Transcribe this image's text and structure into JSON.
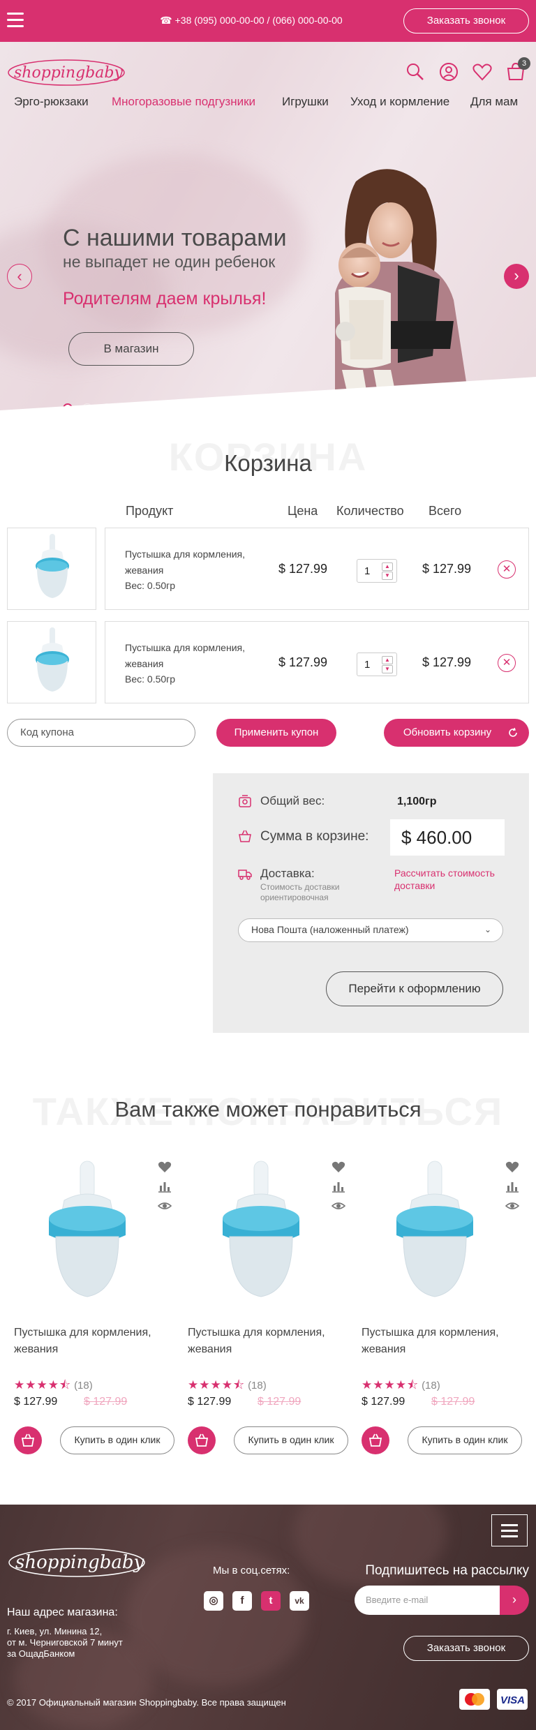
{
  "topbar": {
    "phone": "☎ +38 (095) 000-00-00 / (066) 000-00-00",
    "callback_label": "Заказать звонок"
  },
  "header": {
    "logo_text": "shoppingbaby",
    "cart_count": "3",
    "nav": [
      {
        "label": "Эрго-рюкзаки",
        "active": false
      },
      {
        "label": "Многоразовые подгузники",
        "active": true
      },
      {
        "label": "Игрушки",
        "active": false
      },
      {
        "label": "Уход и кормление",
        "active": false
      },
      {
        "label": "Для мам",
        "active": false
      }
    ]
  },
  "hero": {
    "title_line1": "С нашими товарами",
    "title_line2": "не выпадет не один ребенок",
    "tagline": "Родителям даем крылья!",
    "button_label": "В магазин",
    "arrow_left": "‹",
    "arrow_right": "›",
    "slides": 4,
    "active_slide": 1
  },
  "cart": {
    "watermark": "КОРЗИНА",
    "title": "Корзина",
    "columns": {
      "product": "Продукт",
      "price": "Цена",
      "qty": "Количество",
      "total": "Всего"
    },
    "items": [
      {
        "name": "Пустышка для кормления, жевания",
        "weight": "Вес: 0.50гр",
        "price": "$ 127.99",
        "qty": "1",
        "total": "$ 127.99"
      },
      {
        "name": "Пустышка для кормления, жевания",
        "weight": "Вес: 0.50гр",
        "price": "$ 127.99",
        "qty": "1",
        "total": "$ 127.99"
      }
    ],
    "coupon_placeholder": "Код купона",
    "apply_coupon": "Применить купон",
    "update_cart": "Обновить корзину"
  },
  "summary": {
    "weight_label": "Общий вес:",
    "weight_value": "1,100гр",
    "sum_label": "Сумма в корзине:",
    "sum_value": "$ 460.00",
    "delivery_label": "Доставка:",
    "delivery_note": "Стоимость доставки ориентировочная",
    "delivery_link": "Рассчитать стоимость доставки",
    "delivery_select": "Нова Пошта (наложенный платеж)",
    "checkout_label": "Перейти к оформлению"
  },
  "recommend": {
    "watermark": "ТАКЖЕ ПОНРАВИТЬСЯ",
    "title": "Вам также может понравиться",
    "products": [
      {
        "name": "Пустышка для кормления, жевания",
        "rating": 4.5,
        "stars": "★★★★⯪",
        "reviews": "(18)",
        "price": "$ 127.99",
        "old_price": "$ 127.99",
        "buy_label": "Купить в один клик"
      },
      {
        "name": "Пустышка для кормления, жевания",
        "rating": 4.5,
        "stars": "★★★★⯪",
        "reviews": "(18)",
        "price": "$ 127.99",
        "old_price": "$ 127.99",
        "buy_label": "Купить в один клик"
      },
      {
        "name": "Пустышка для кормления, жевания",
        "rating": 4.5,
        "stars": "★★★★⯪",
        "reviews": "(18)",
        "price": "$ 127.99",
        "old_price": "$ 127.99",
        "buy_label": "Купить в один клик"
      }
    ]
  },
  "footer": {
    "logo_text": "shoppingbaby",
    "social_title": "Мы в соц.сетях:",
    "social": [
      {
        "icon": "instagram-icon",
        "glyph": "◎"
      },
      {
        "icon": "facebook-icon",
        "glyph": "f"
      },
      {
        "icon": "twitter-icon",
        "glyph": "t"
      },
      {
        "icon": "vk-icon",
        "glyph": "vk"
      }
    ],
    "newsletter_title": "Подпишитесь на рассылку",
    "email_placeholder": "Введите e-mail",
    "address_title": "Наш адрес магазина:",
    "address_lines": [
      "г. Киев, ул. Минина 12,",
      "от м. Черниговской 7 минут",
      "за ОщадБанком"
    ],
    "callback_label": "Заказать звонок",
    "copyright": "© 2017 Официальный магазин Shoppingbaby. Все права защищен",
    "cards": [
      "MasterCard",
      "VISA"
    ]
  },
  "colors": {
    "accent": "#d8306f",
    "footer_bg": "#4a3535",
    "summary_bg": "#ececec"
  }
}
